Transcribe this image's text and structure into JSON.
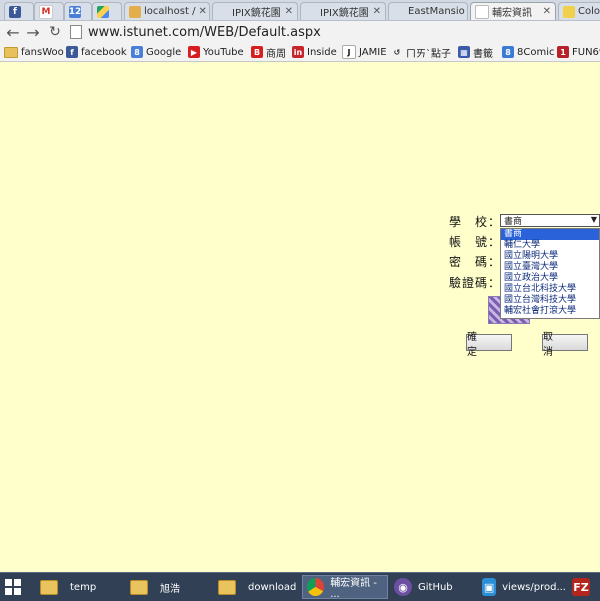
{
  "browser": {
    "tabs": [
      {
        "label": "",
        "icon": "facebook-icon"
      },
      {
        "label": "",
        "icon": "gmail-icon"
      },
      {
        "label": "",
        "icon": "calendar-icon"
      },
      {
        "label": "",
        "icon": "drive-icon"
      },
      {
        "label": "localhost /",
        "icon": "page-icon"
      },
      {
        "label": "IPIX鏡花園",
        "icon": "page-icon"
      },
      {
        "label": "IPIX鏡花園",
        "icon": "page-icon"
      },
      {
        "label": "EastMansio",
        "icon": "page-icon"
      },
      {
        "label": "輔宏資訊",
        "icon": "page-icon",
        "active": true
      },
      {
        "label": "Color",
        "icon": "page-icon"
      }
    ],
    "url": "www.istunet.com/WEB/Default.aspx",
    "bookmarks": [
      {
        "label": "fansWoo",
        "icon": "folder-icon"
      },
      {
        "label": "facebook",
        "icon": "facebook-icon"
      },
      {
        "label": "Google",
        "icon": "google-icon"
      },
      {
        "label": "YouTube",
        "icon": "youtube-icon"
      },
      {
        "label": "商周",
        "icon": "b-icon"
      },
      {
        "label": "Inside",
        "icon": "inside-icon"
      },
      {
        "label": "JAMIE",
        "icon": "j-icon"
      },
      {
        "label": "ㄇㄞˋ點子",
        "icon": "link-icon"
      },
      {
        "label": "書籤",
        "icon": "grid-icon"
      },
      {
        "label": "8Comic",
        "icon": "8comic-icon"
      },
      {
        "label": "FUN69",
        "icon": "fun-icon"
      }
    ]
  },
  "login": {
    "school_label": "學　校：",
    "account_label": "帳　號：",
    "password_label": "密　碼：",
    "captcha_label": "驗證碼：",
    "school_selected": "書商",
    "school_options": [
      "書商",
      "輔仁大學",
      "國立陽明大學",
      "國立臺灣大學",
      "國立政治大學",
      "國立台北科技大學",
      "國立台灣科技大學",
      "輔宏社會打滾大學"
    ],
    "confirm_label": "確　定",
    "cancel_label": "取　消"
  },
  "taskbar": {
    "items": [
      {
        "label": "temp",
        "icon": "folder-icon"
      },
      {
        "label": "旭浩",
        "icon": "user-folder-icon"
      },
      {
        "label": "download",
        "icon": "folder-icon"
      },
      {
        "label": "輔宏資訊 - ...",
        "icon": "chrome-icon",
        "active": true
      },
      {
        "label": "GitHub",
        "icon": "github-icon"
      },
      {
        "label": "views/prod...",
        "icon": "editor-icon"
      },
      {
        "label": "",
        "icon": "filezilla-icon"
      }
    ]
  },
  "colors": {
    "page_background": "#ffffcc",
    "selected_option": "#2a62d9",
    "taskbar": "#314055"
  }
}
